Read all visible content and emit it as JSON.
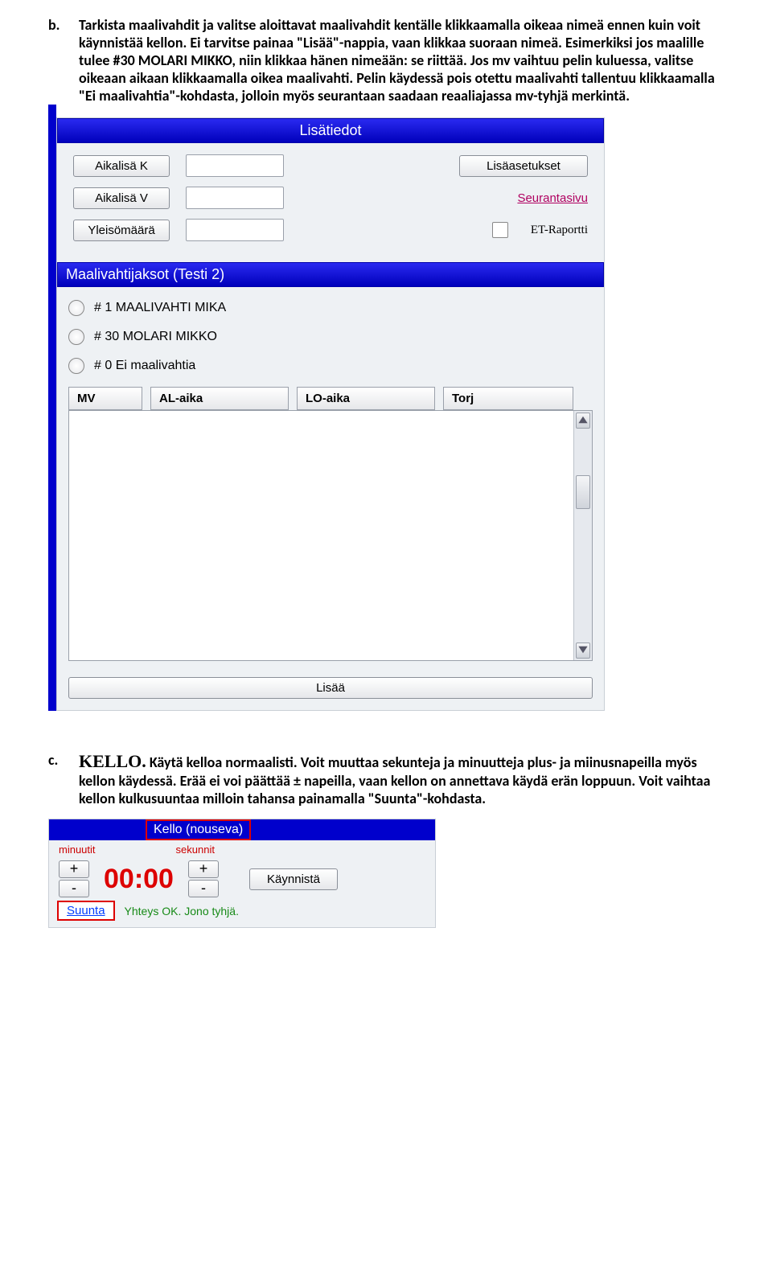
{
  "section_b": {
    "marker": "b.",
    "text": "Tarkista maalivahdit ja valitse aloittavat maalivahdit kentälle klikkaamalla oikeaa nimeä ennen kuin voit käynnistää kellon. Ei tarvitse painaa \"Lisää\"-nappia, vaan klikkaa suoraan nimeä. Esimerkiksi jos maalille tulee #30 MOLARI MIKKO, niin klikkaa hänen nimeään: se riittää. Jos mv vaihtuu pelin kuluessa, valitse oikeaan aikaan klikkaamalla oikea maalivahti. Pelin käydessä pois otettu maalivahti tallentuu klikkaamalla \"Ei maalivahtia\"-kohdasta, jolloin myös seurantaan saadaan reaaliajassa mv-tyhjä merkintä."
  },
  "lisatiedot": {
    "title": "Lisätiedot",
    "aikalisaK": "Aikalisä K",
    "aikalisaV": "Aikalisä V",
    "yleisomaara": "Yleisömäärä",
    "lisaasetukset": "Lisäasetukset",
    "seurantasivu": "Seurantasivu",
    "etraportti": "ET-Raportti"
  },
  "mv": {
    "title": "Maalivahtijaksot (Testi 2)",
    "opt1": "# 1 MAALIVAHTI MIKA",
    "opt2": "# 30 MOLARI MIKKO",
    "opt3": "# 0 Ei maalivahtia",
    "h_mv": "MV",
    "h_al": "AL-aika",
    "h_lo": "LO-aika",
    "h_torj": "Torj",
    "lisaa": "Lisää"
  },
  "section_c": {
    "marker": "c.",
    "bigword": "KELLO.",
    "text": " Käytä kelloa normaalisti. Voit muuttaa sekunteja ja minuutteja plus- ja miinusnapeilla myös kellon käydessä. Erää ei voi päättää ± napeilla, vaan kellon on annettava käydä erän loppuun. Voit vaihtaa kellon kulkusuuntaa milloin tahansa painamalla \"Suunta\"-kohdasta."
  },
  "clock": {
    "title": "Kello (nouseva)",
    "min_label": "minuutit",
    "sec_label": "sekunnit",
    "plus": "+",
    "minus": "-",
    "time": "00:00",
    "start": "Käynnistä",
    "suunta": "Suunta",
    "status": "Yhteys OK. Jono tyhjä."
  }
}
